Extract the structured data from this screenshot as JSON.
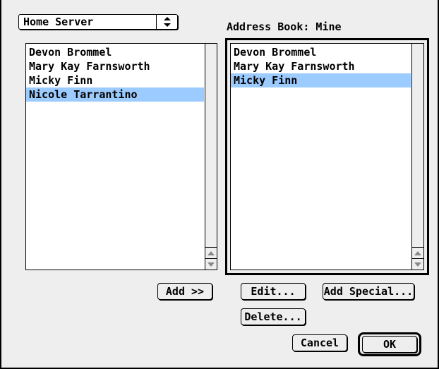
{
  "server_popup": {
    "selected": "Home Server"
  },
  "address_book": {
    "label": "Address Book: Mine"
  },
  "left_list": {
    "items": [
      {
        "label": "Devon Brommel",
        "selected": false
      },
      {
        "label": "Mary Kay Farnsworth",
        "selected": false
      },
      {
        "label": "Micky Finn",
        "selected": false
      },
      {
        "label": "Nicole Tarrantino",
        "selected": true
      }
    ]
  },
  "right_list": {
    "items": [
      {
        "label": "Devon Brommel",
        "selected": false
      },
      {
        "label": "Mary Kay Farnsworth",
        "selected": false
      },
      {
        "label": "Micky Finn",
        "selected": true
      }
    ]
  },
  "buttons": {
    "add": "Add >>",
    "edit": "Edit...",
    "add_special": "Add Special...",
    "delete": "Delete...",
    "cancel": "Cancel",
    "ok": "OK"
  },
  "colors": {
    "selection": "#9ccbff",
    "dialog_bg": "#eeeeee"
  },
  "icons": {
    "popup": "up-down-arrows-icon",
    "scroll_up": "scroll-up-arrow-icon",
    "scroll_down": "scroll-down-arrow-icon"
  }
}
